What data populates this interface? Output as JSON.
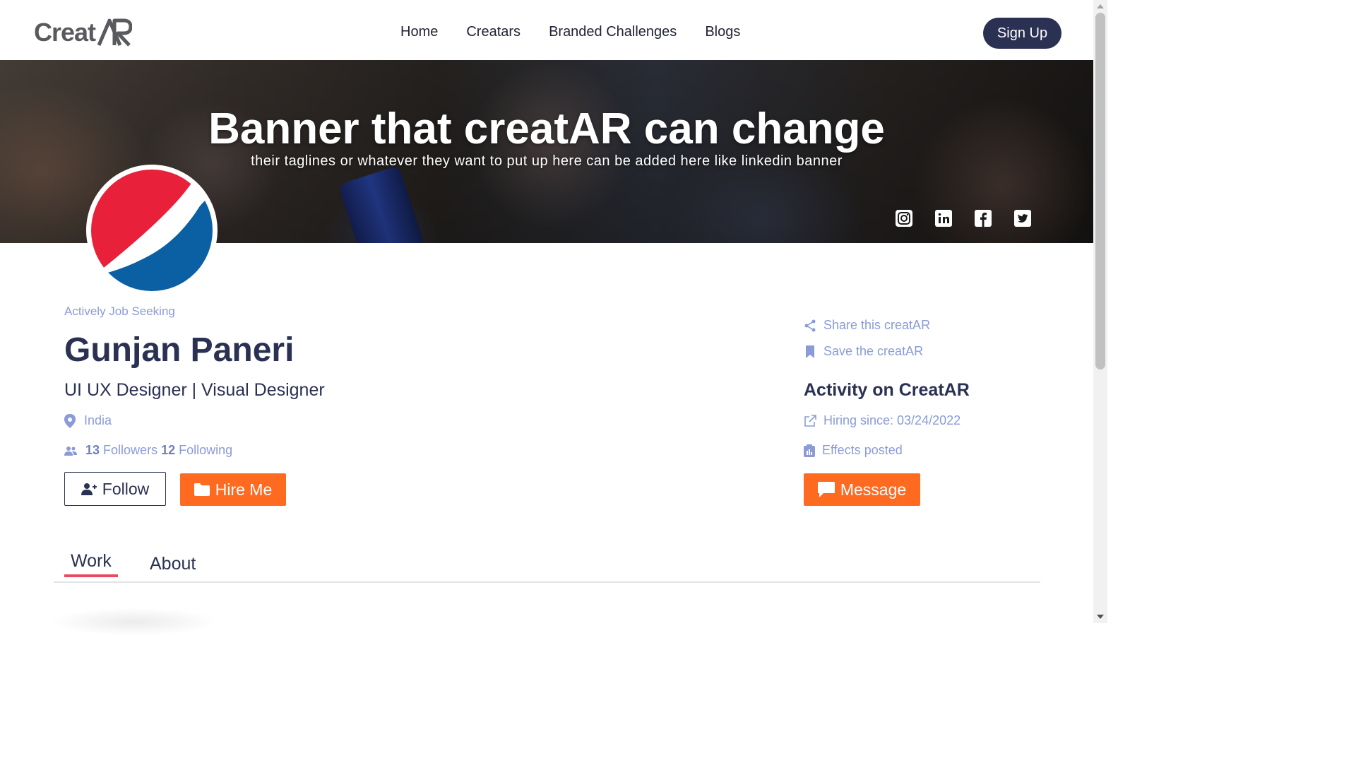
{
  "header": {
    "logo_text": "Creat",
    "logo_ar": "AR",
    "nav": [
      "Home",
      "Creatars",
      "Branded Challenges",
      "Blogs"
    ],
    "signup_label": "Sign Up"
  },
  "banner": {
    "title": "Banner that creatAR can change",
    "subtitle": "their taglines or whatever they want to put up here can be added here like linkedin banner",
    "socials": [
      "instagram-icon",
      "linkedin-icon",
      "facebook-icon",
      "twitter-icon"
    ]
  },
  "profile": {
    "status": "Actively Job Seeking",
    "name": "Gunjan Paneri",
    "role": "UI UX Designer | Visual Designer",
    "location": "India",
    "followers_count": "13",
    "followers_label": "Followers",
    "following_count": "12",
    "following_label": "Following",
    "follow_label": "Follow",
    "hire_label": "Hire Me"
  },
  "sidebar": {
    "share_label": "Share this creatAR",
    "save_label": "Save the creatAR",
    "activity_title": "Activity on CreatAR",
    "hiring_since": "Hiring since: 03/24/2022",
    "effects_posted": "Effects posted",
    "message_label": "Message"
  },
  "tabs": [
    "Work",
    "About"
  ],
  "colors": {
    "primary": "#2b3152",
    "accent_orange": "#ff6a21",
    "muted_blue": "#8a9bd8",
    "tab_underline": "#e84a5f",
    "pepsi_red": "#e8203a",
    "pepsi_blue": "#0b5fa3"
  }
}
